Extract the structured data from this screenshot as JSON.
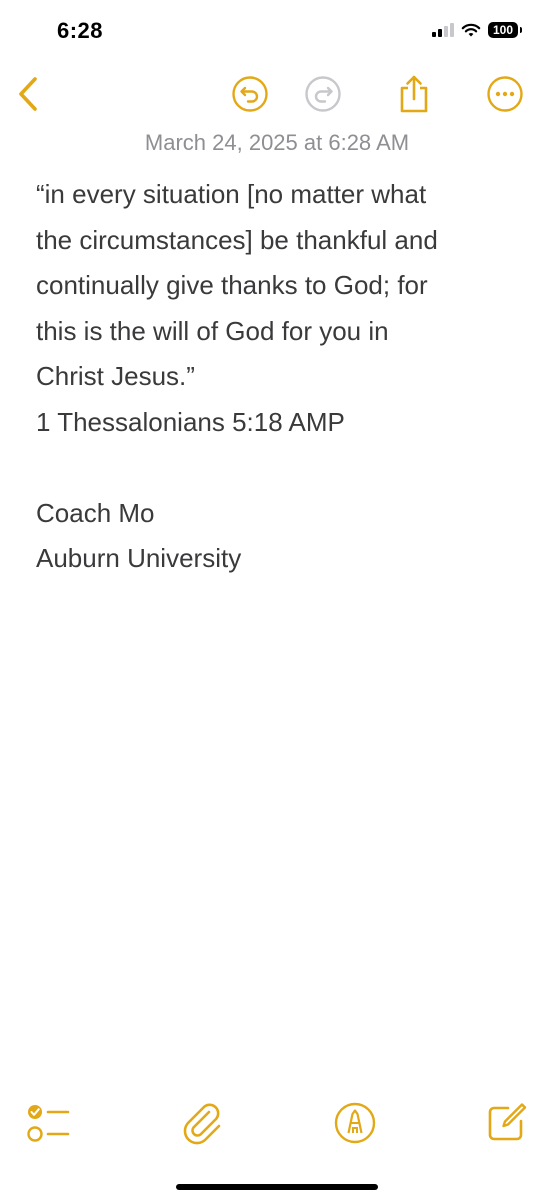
{
  "status_bar": {
    "time": "6:28",
    "battery": "100"
  },
  "toolbar": {
    "back_icon": "chevron-left-icon",
    "undo_icon": "undo-icon",
    "redo_icon": "redo-icon",
    "share_icon": "share-icon",
    "more_icon": "ellipsis-circle-icon"
  },
  "note": {
    "date": "March 24, 2025 at 6:28 AM",
    "lines": [
      "“in every situation [no matter what",
      "the circumstances] be thankful and",
      "continually give thanks to God; for",
      "this is the will of God for you in",
      "Christ Jesus.”",
      "1 Thessalonians 5:18 AMP",
      "",
      "Coach Mo",
      "Auburn University"
    ]
  },
  "bottom_bar": {
    "checklist_icon": "checklist-icon",
    "attach_icon": "paperclip-icon",
    "markup_icon": "markup-pen-icon",
    "compose_icon": "compose-icon"
  },
  "colors": {
    "accent": "#E3A816",
    "disabled": "#C7C7CC",
    "date_text": "#8E8E93",
    "body_text": "#3A3A3C"
  }
}
